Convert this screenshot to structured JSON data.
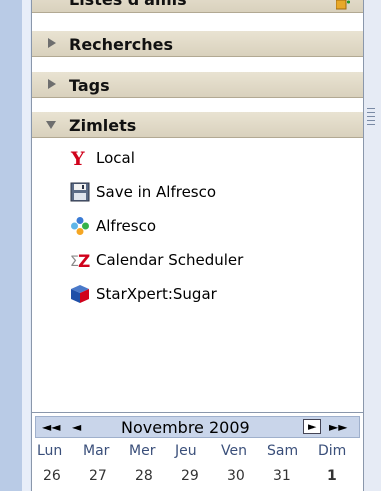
{
  "sections": {
    "listes": "Listes d'amis",
    "recherches": "Recherches",
    "tags": "Tags",
    "zimlets": "Zimlets"
  },
  "zimlets": [
    {
      "label": "Local",
      "icon": "yahoo-y-icon"
    },
    {
      "label": "Save in Alfresco",
      "icon": "floppy-disk-icon"
    },
    {
      "label": "Alfresco",
      "icon": "alfresco-flower-icon"
    },
    {
      "label": "Calendar Scheduler",
      "icon": "calendar-scheduler-icon"
    },
    {
      "label": "StarXpert:Sugar",
      "icon": "sugar-cube-icon"
    }
  ],
  "calendar": {
    "month": "Novembre 2009",
    "prev_year": "◄◄",
    "prev_month": "◄",
    "next_month": "►",
    "next_year": "►►",
    "days": [
      "Lun",
      "Mar",
      "Mer",
      "Jeu",
      "Ven",
      "Sam",
      "Dim"
    ],
    "dates": [
      "26",
      "27",
      "28",
      "29",
      "30",
      "31",
      "1"
    ]
  },
  "colors": {
    "accordion": "#e1dac7",
    "panel_bg": "#ffffff",
    "calendar_header": "#c9d5ea",
    "yahoo_red": "#d0021b"
  }
}
